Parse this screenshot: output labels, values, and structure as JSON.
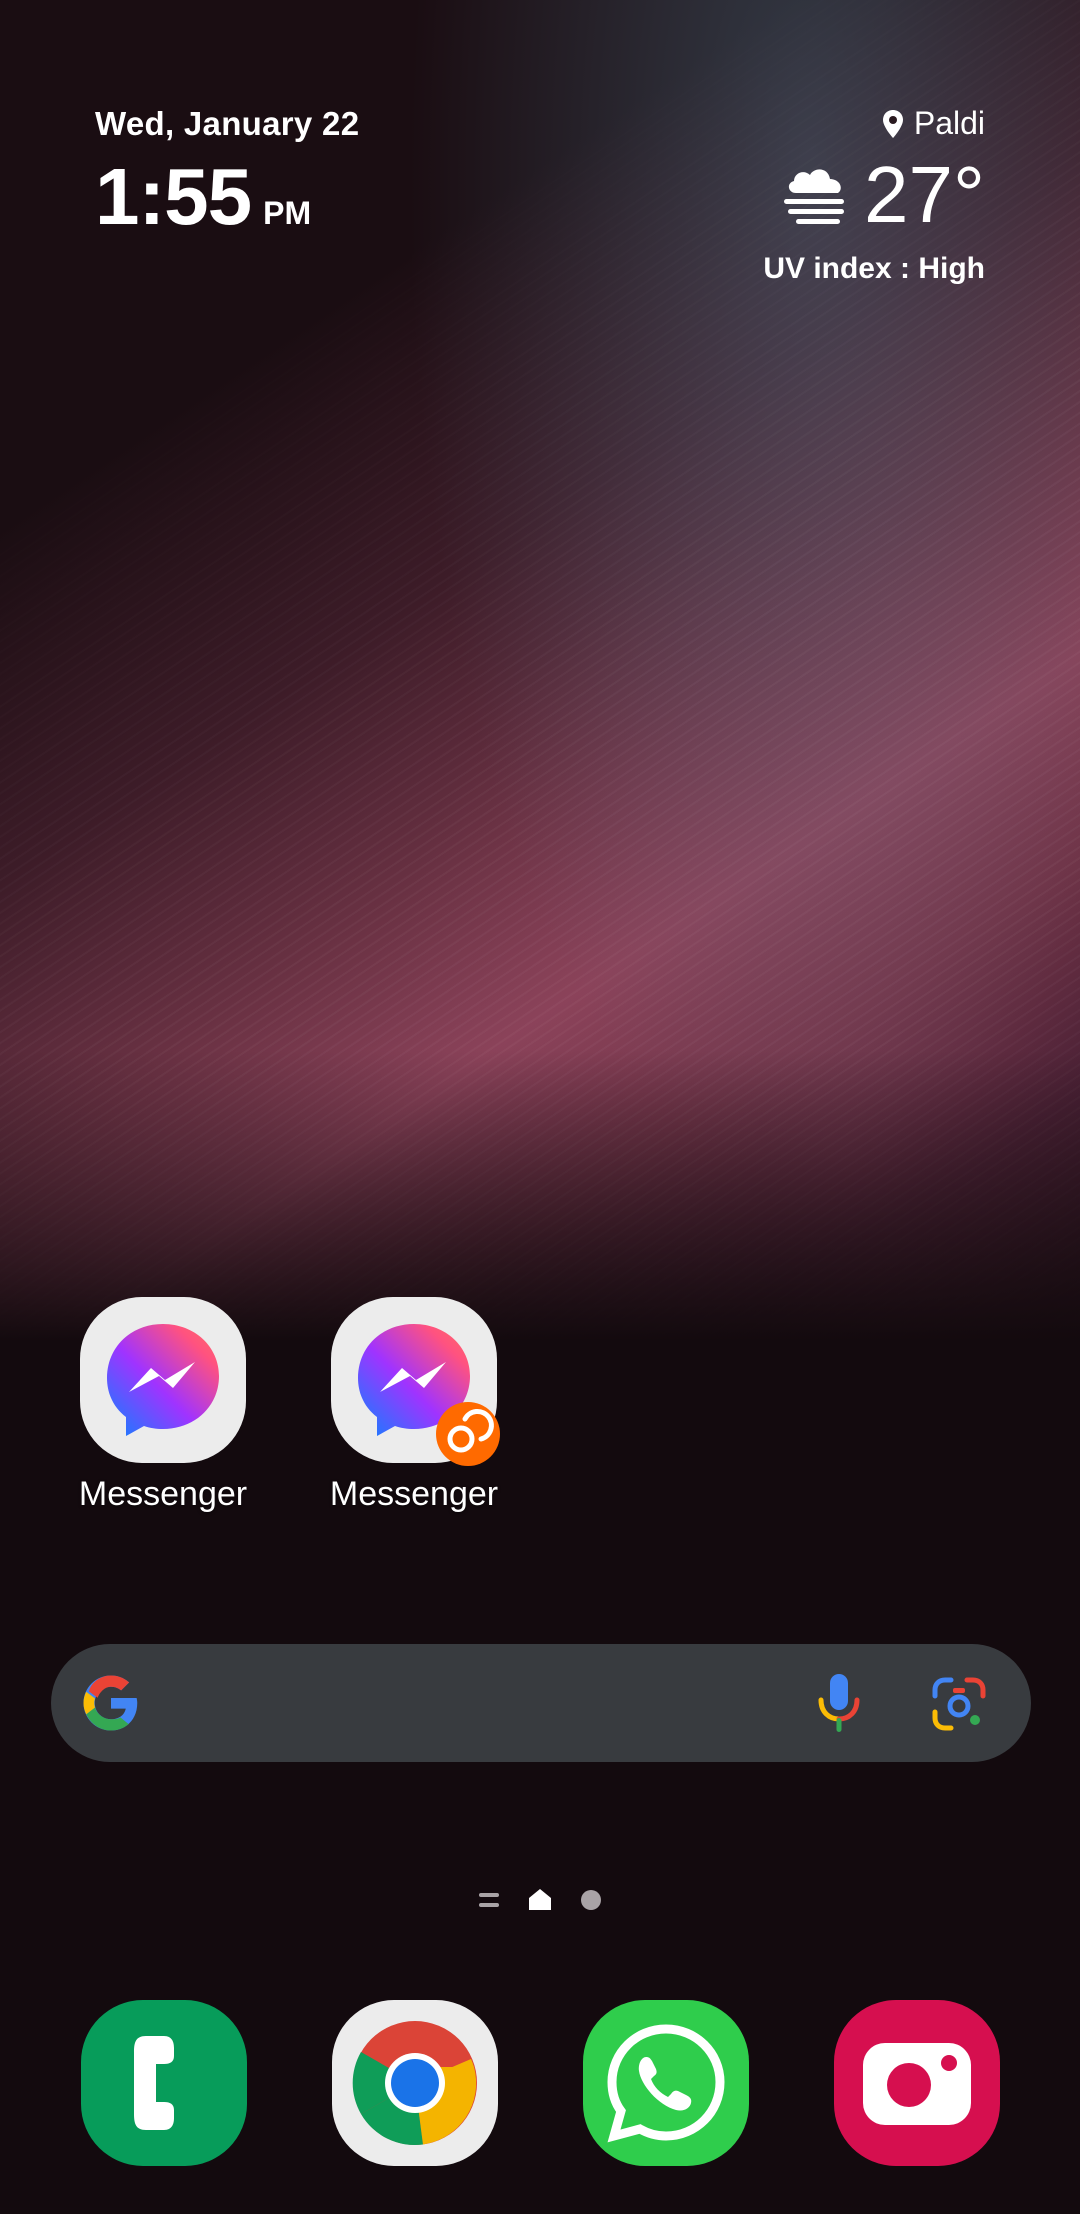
{
  "clock": {
    "date": "Wed, January 22",
    "time": "1:55",
    "ampm": "PM"
  },
  "weather": {
    "location": "Paldi",
    "temperature": "27°",
    "uv": "UV index : High",
    "condition_icon": "fog-cloud-icon"
  },
  "apps": [
    {
      "label": "Messenger",
      "icon": "messenger-icon"
    },
    {
      "label": "Messenger",
      "icon": "messenger-icon",
      "badge": "dual-app-badge-icon"
    }
  ],
  "search_bar": {
    "logo": "google-g-icon",
    "voice": "microphone-icon",
    "lens": "google-lens-icon"
  },
  "page_indicator": {
    "pages": 3,
    "current": 1
  },
  "dock": [
    {
      "app": "Phone",
      "icon": "phone-icon",
      "color": "#079c5a"
    },
    {
      "app": "Chrome",
      "icon": "chrome-icon",
      "color": "#ececec"
    },
    {
      "app": "WhatsApp",
      "icon": "whatsapp-icon",
      "color": "#2fcd4c"
    },
    {
      "app": "Camera",
      "icon": "camera-icon",
      "color": "#d60f4f"
    }
  ]
}
